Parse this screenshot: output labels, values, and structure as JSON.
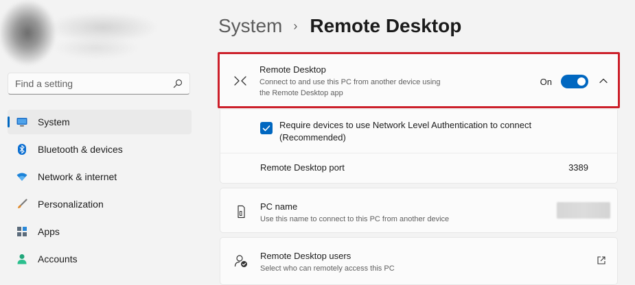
{
  "search": {
    "placeholder": "Find a setting"
  },
  "nav": {
    "items": [
      {
        "label": "System",
        "icon": "monitor-icon",
        "active": true
      },
      {
        "label": "Bluetooth & devices",
        "icon": "bluetooth-icon"
      },
      {
        "label": "Network & internet",
        "icon": "wifi-icon"
      },
      {
        "label": "Personalization",
        "icon": "brush-icon"
      },
      {
        "label": "Apps",
        "icon": "apps-icon"
      },
      {
        "label": "Accounts",
        "icon": "person-icon"
      }
    ]
  },
  "breadcrumb": {
    "parent": "System",
    "separator": "›",
    "current": "Remote Desktop"
  },
  "remote_desktop": {
    "title": "Remote Desktop",
    "description_line1": "Connect to and use this PC from another device using",
    "description_line2": "the Remote Desktop app",
    "toggle_label": "On",
    "enabled": true,
    "nla_line1": "Require devices to use Network Level Authentication to connect",
    "nla_line2": "(Recommended)",
    "nla_checked": true,
    "port_label": "Remote Desktop port",
    "port_value": "3389"
  },
  "pc_name": {
    "title": "PC name",
    "description": "Use this name to connect to this PC from another device"
  },
  "users": {
    "title": "Remote Desktop users",
    "description": "Select who can remotely access this PC"
  },
  "colors": {
    "accent": "#0067c0",
    "highlight_border": "#cc1f2a"
  }
}
